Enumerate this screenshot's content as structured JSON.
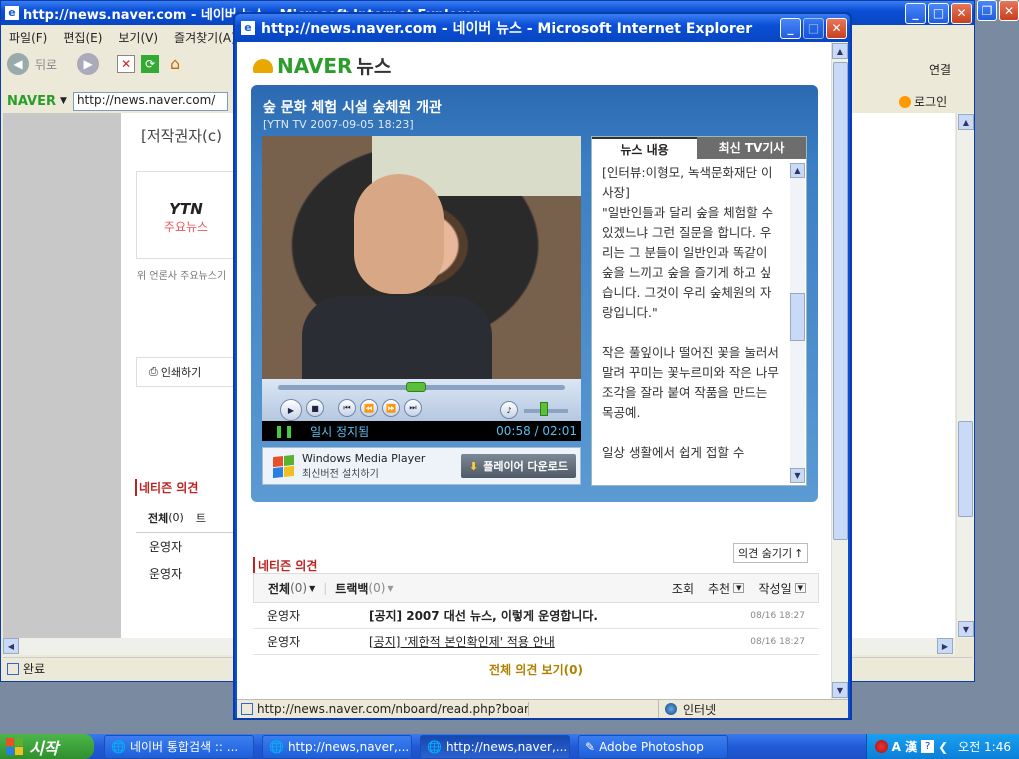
{
  "bg_window": {
    "title": "http://news.naver.com - 네이버 뉴스 - Microsoft Internet Explorer",
    "menu": [
      "파일(F)",
      "편집(E)",
      "보기(V)",
      "즐겨찾기(A)"
    ],
    "back": "뒤로",
    "address": "http://news.naver.com/",
    "naver": "NAVER",
    "links": "연결",
    "login": "로그인",
    "copyright": "[저작권자(c)",
    "ytn": "YTN",
    "ytn_sub": "주요뉴스",
    "press_note": "위 언론사 주요뉴스기",
    "print": "인쇄하기",
    "netizen": "네티즌 의견",
    "tab_all": "전체",
    "tab_all_count": "(0)",
    "tab_tb": "트",
    "op1": "운영자",
    "op2": "운영자",
    "status": "완료"
  },
  "popup": {
    "title": "http://news.naver.com - 네이버 뉴스 - Microsoft Internet Explorer",
    "logo": "NAVER",
    "logo_news": "뉴스",
    "headline": "숲 문화 체험 시설 숲체원 개관",
    "source": "[YTN TV 2007-09-05 18:23]",
    "player": {
      "status": "일시 정지됨",
      "time": "00:58 / 02:01",
      "wmp_name": "Windows Media Player",
      "wmp_sub": "최신버전 설치하기",
      "download": "플레이어 다운로드",
      "progress": 0.48,
      "volume": 0.45
    },
    "tabs": [
      "뉴스 내용",
      "최신 TV기사"
    ],
    "article": [
      "[인터뷰:이형모, 녹색문화재단 이사장]",
      "\"일반인들과 달리 숲을 체험할 수 있겠느냐 그런 질문을 합니다. 우리는 그 분들이 일반인과 똑같이 숲을 느끼고 숲을 즐기게 하고 싶습니다. 그것이 우리 숲체원의 자랑입니다.\"",
      "작은 풀잎이나 떨어진 꽃을 눌러서 말려 꾸미는 꽃누르미와 작은 나무 조각을 잘라 붙여 작품을 만드는 목공예.",
      "일상 생활에서 쉽게 접할 수"
    ],
    "netizen": "네티즌 의견",
    "hide_btn": "의견 숨기기",
    "tab_all": "전체",
    "tab_all_count": "(0)",
    "tab_tb": "트랙백",
    "tab_tb_count": "(0)",
    "sort": [
      "조회",
      "추천",
      "작성일"
    ],
    "rows": [
      {
        "author": "운영자",
        "text": "[공지] 2007 대선 뉴스, 이렇게 운영합니다.",
        "date": "08/16 18:27"
      },
      {
        "author": "운영자",
        "text": "[공지] '제한적 본인확인제' 적용 안내",
        "date": "08/16 18:27"
      }
    ],
    "view_all": "전체 의견 보기",
    "view_all_count": "(0)",
    "status_url": "http://news.naver.com/nboard/read.php?board",
    "zone": "인터넷"
  },
  "taskbar": {
    "start": "시작",
    "items": [
      "네이버 통합검색 :: ...",
      "http://news,naver,...",
      "http://news,naver,...",
      "Adobe Photoshop"
    ],
    "tray_lang": "A 漢",
    "clock": "오전 1:46"
  }
}
